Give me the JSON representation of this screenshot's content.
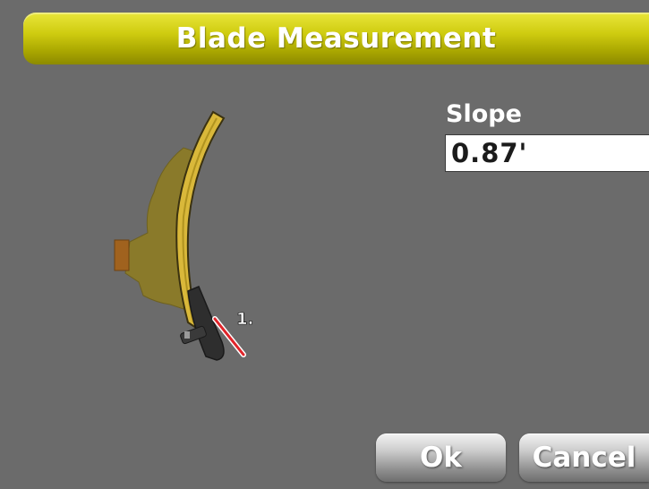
{
  "window": {
    "title": "Blade Measurement"
  },
  "measurement": {
    "label": "Slope",
    "value": "0.87'"
  },
  "blade": {
    "point_marker": "1."
  },
  "buttons": {
    "ok_label": "Ok",
    "cancel_label": "Cancel"
  },
  "colors": {
    "background": "#6b6b6b",
    "title_bar": "#cfcc10",
    "blade": "#d9b83a",
    "measure_line": "#e0242a"
  }
}
